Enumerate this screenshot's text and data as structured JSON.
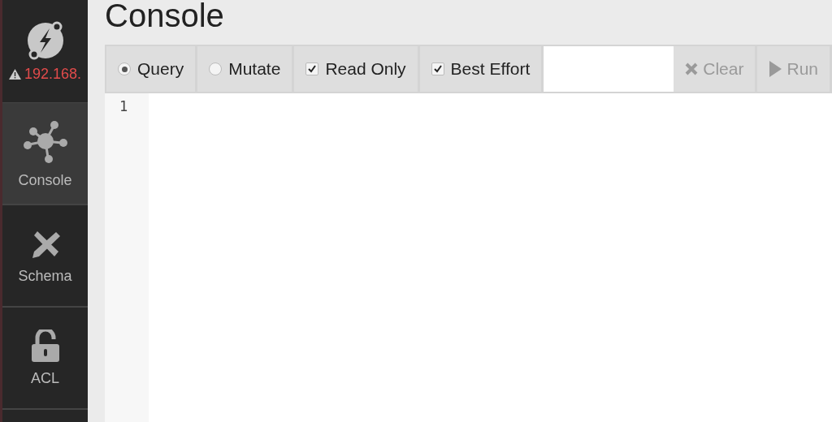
{
  "server": {
    "address": "192.168.",
    "warning": true
  },
  "nav": [
    {
      "label": "Console",
      "kind": "console",
      "selected": true
    },
    {
      "label": "Schema",
      "kind": "schema",
      "selected": false
    },
    {
      "label": "ACL",
      "kind": "acl",
      "selected": false
    }
  ],
  "page_title": "Console",
  "modes": [
    {
      "label": "Query",
      "selected": true
    },
    {
      "label": "Mutate",
      "selected": false
    }
  ],
  "options": [
    {
      "label": "Read Only",
      "checked": true
    },
    {
      "label": "Best Effort",
      "checked": true
    }
  ],
  "actions": [
    {
      "label": "Clear",
      "kind": "clear",
      "disabled": true
    },
    {
      "label": "Run",
      "kind": "run",
      "disabled": true
    }
  ],
  "editor": {
    "line_numbers": [
      "1"
    ]
  }
}
